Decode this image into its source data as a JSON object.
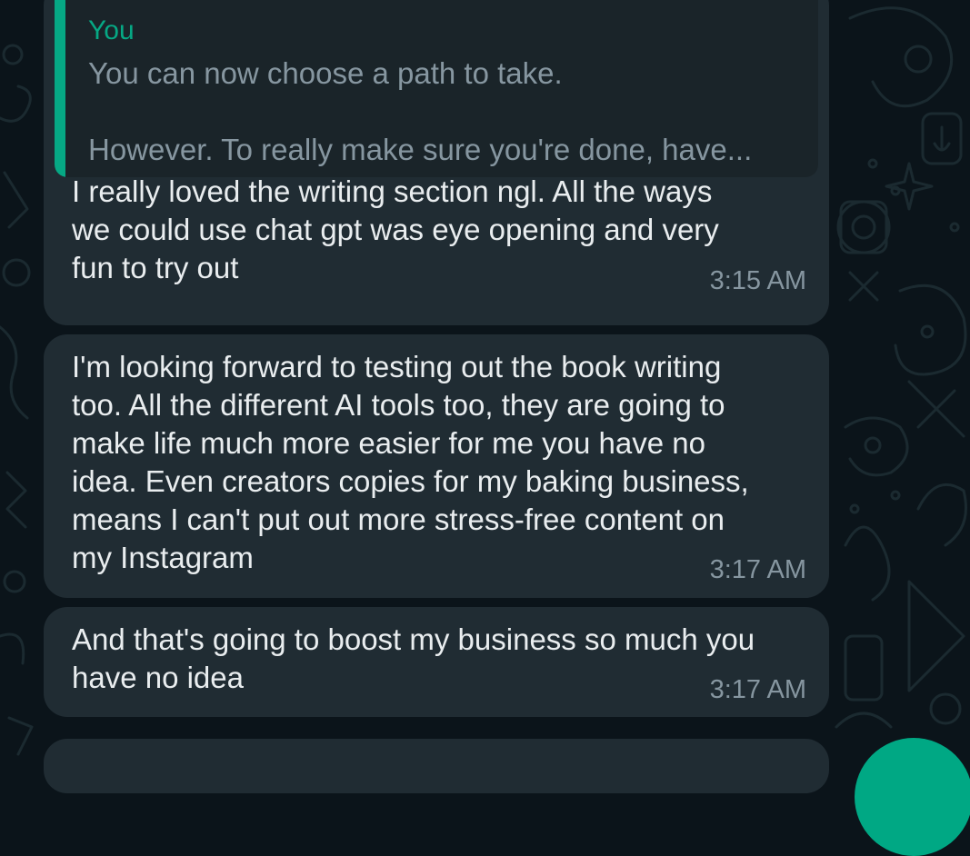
{
  "colors": {
    "background": "#0b141a",
    "bubble": "#202c33",
    "quote_accent": "#06a884",
    "primary_text": "#e9edef",
    "secondary_text": "#8696a0",
    "fab": "#00a884"
  },
  "messages": [
    {
      "quote": {
        "author": "You",
        "lines": [
          "You can now choose a path to take.",
          "However. To really make sure you're done, have..."
        ]
      },
      "text": "I really loved the writing section ngl. All the ways\nwe could use chat gpt was eye opening and very\nfun to try out",
      "time": "3:15 AM"
    },
    {
      "text": "I'm looking forward to testing out the book writing\ntoo. All the different AI tools too, they are going to\nmake life much more easier for me you have no\nidea. Even creators copies for my baking business,\nmeans I can't put out more stress-free content on\nmy Instagram",
      "time": "3:17 AM"
    },
    {
      "text": "And that's going to boost my business so much you\nhave no idea",
      "time": "3:17 AM"
    }
  ]
}
